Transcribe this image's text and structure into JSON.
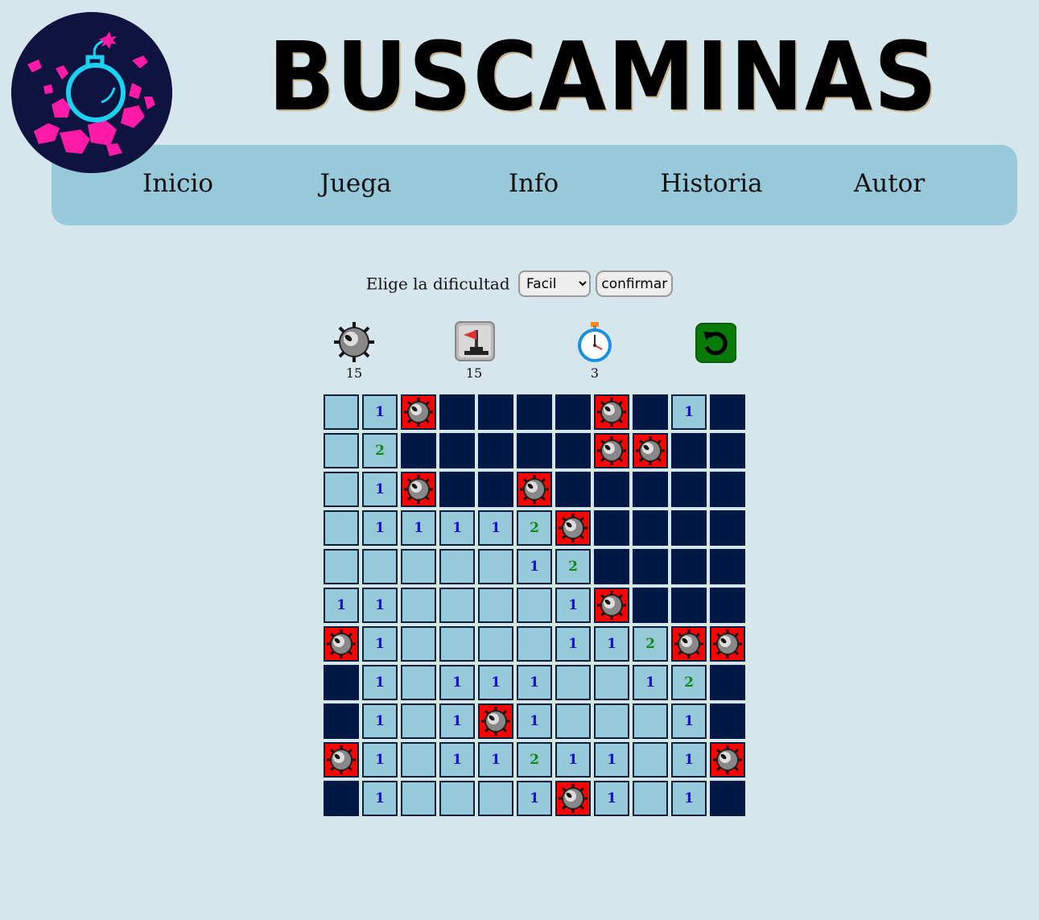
{
  "header": {
    "title": "BUSCAMINAS"
  },
  "nav": {
    "items": [
      {
        "label": "Inicio"
      },
      {
        "label": "Juega"
      },
      {
        "label": "Info"
      },
      {
        "label": "Historia"
      },
      {
        "label": "Autor"
      }
    ]
  },
  "difficulty": {
    "label": "Elige la dificultad",
    "selected": "Facil",
    "confirm_label": "confirmar"
  },
  "stats": {
    "mines": "15",
    "flags": "15",
    "timer": "3"
  },
  "colors": {
    "page_bg": "#d6e6ed",
    "nav_bg": "#98c9da",
    "hidden_cell": "#011845",
    "revealed_cell": "#98c9da",
    "mine_cell": "#ff0000",
    "number_1": "#1010d8",
    "number_2": "#118a11",
    "restart_button": "#0a7a0a"
  },
  "board": {
    "rows": [
      [
        "e",
        "1",
        "M",
        "H",
        "H",
        "H",
        "H",
        "M",
        "H",
        "1"
      ],
      [
        "e",
        "2",
        "H",
        "H",
        "H",
        "H",
        "H",
        "M",
        "M",
        "H"
      ],
      [
        "e",
        "1",
        "M",
        "H",
        "H",
        "M",
        "H",
        "H",
        "H",
        "H"
      ],
      [
        "e",
        "1",
        "1",
        "1",
        "1",
        "2",
        "M",
        "H",
        "H",
        "H"
      ],
      [
        "e",
        "e",
        "e",
        "e",
        "e",
        "1",
        "2",
        "H",
        "H",
        "H"
      ],
      [
        "1",
        "1",
        "e",
        "e",
        "e",
        "e",
        "1",
        "M",
        "H",
        "H"
      ],
      [
        "M",
        "1",
        "e",
        "e",
        "e",
        "e",
        "1",
        "1",
        "2",
        "M",
        "M"
      ],
      [
        "H",
        "1",
        "e",
        "1",
        "1",
        "1",
        "e",
        "e",
        "1",
        "2",
        "H"
      ],
      [
        "H",
        "1",
        "e",
        "1",
        "M",
        "1",
        "e",
        "e",
        "e",
        "1",
        "H"
      ],
      [
        "M",
        "1",
        "e",
        "1",
        "1",
        "2",
        "1",
        "1",
        "e",
        "1",
        "M"
      ],
      [
        "H",
        "1",
        "e",
        "e",
        "e",
        "1",
        "M",
        "1",
        "e",
        "1",
        "H"
      ]
    ]
  }
}
